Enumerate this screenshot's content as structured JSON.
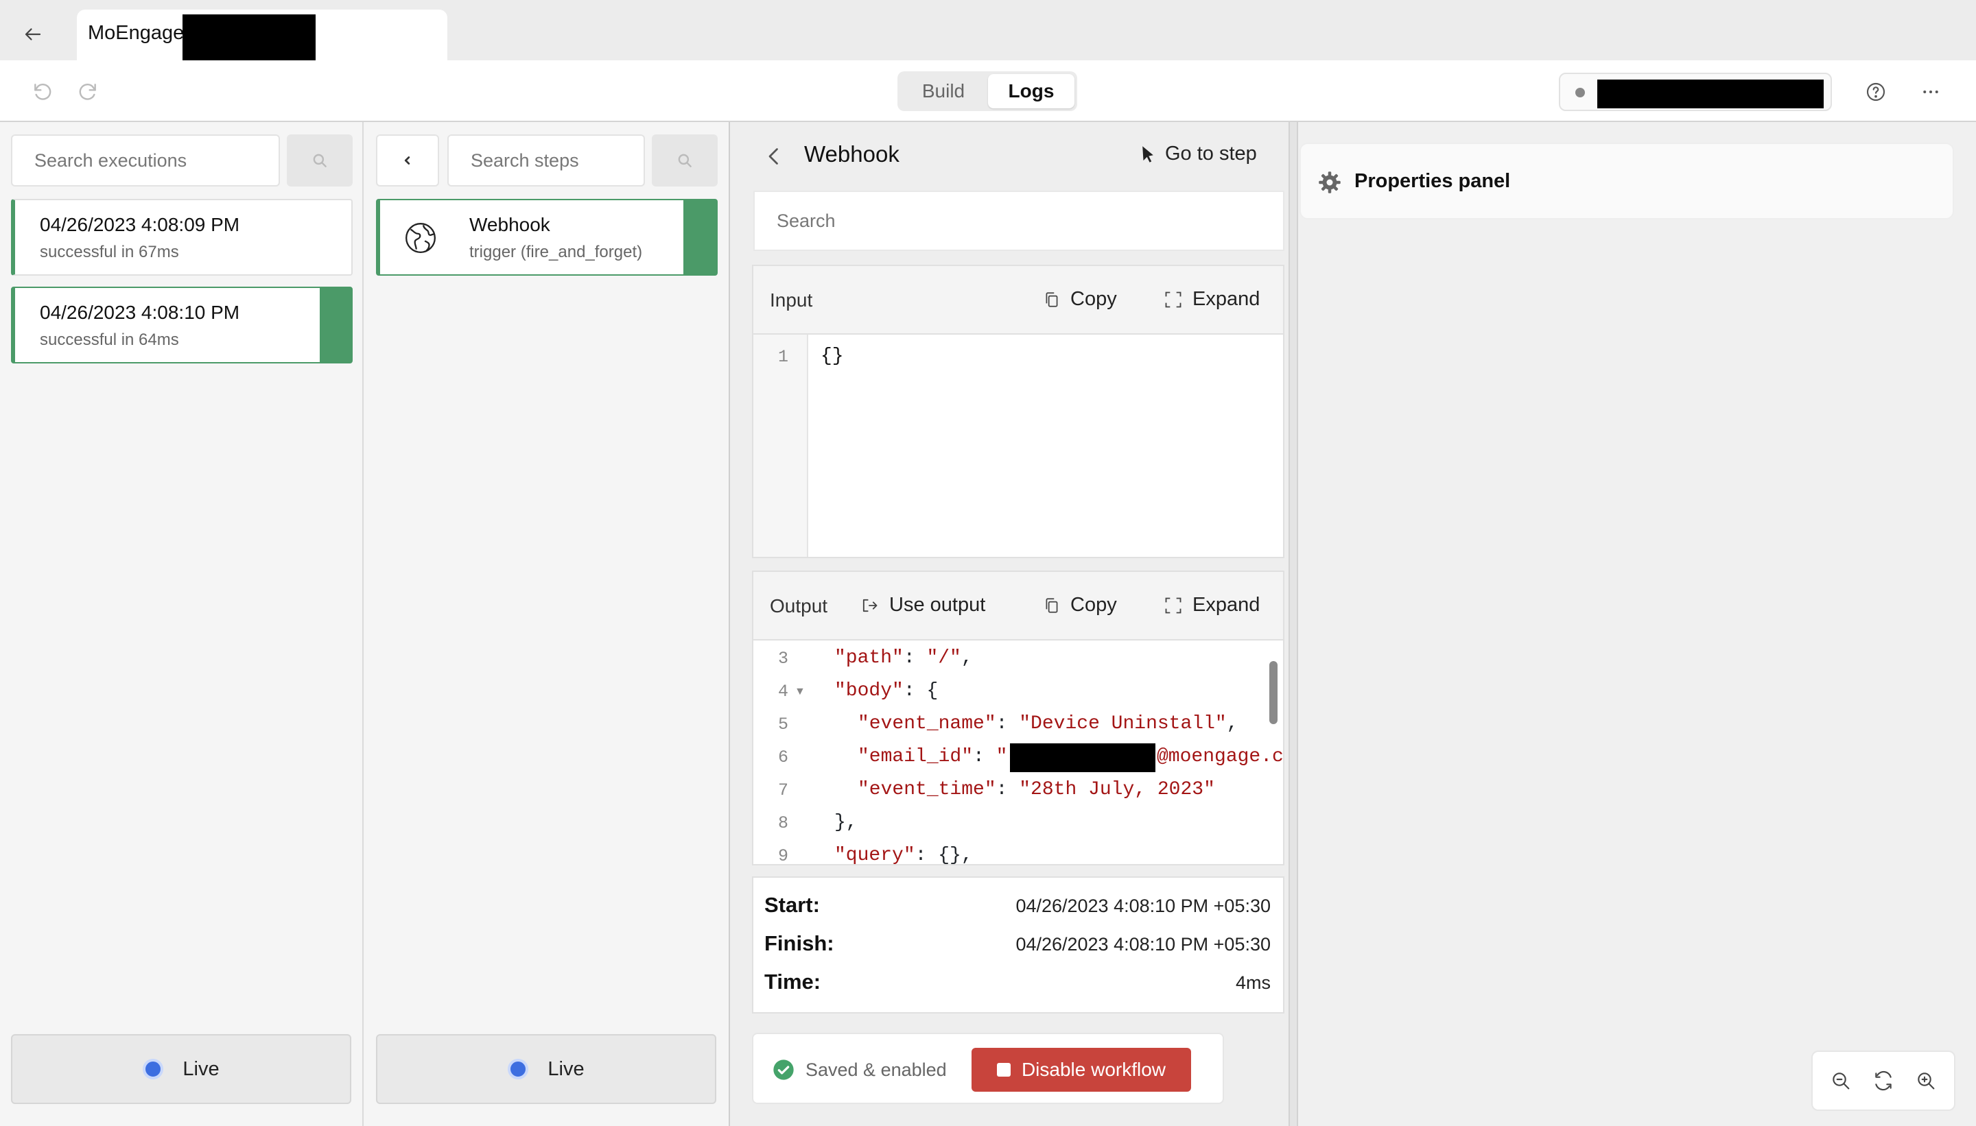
{
  "tab": {
    "title": "MoEngage"
  },
  "toolbar": {
    "build_label": "Build",
    "logs_label": "Logs"
  },
  "executions": {
    "search_placeholder": "Search executions",
    "items": [
      {
        "timestamp": "04/26/2023 4:08:09 PM",
        "status": "successful in 67ms"
      },
      {
        "timestamp": "04/26/2023 4:08:10 PM",
        "status": "successful in 64ms"
      }
    ],
    "live_label": "Live"
  },
  "steps": {
    "search_placeholder": "Search steps",
    "items": [
      {
        "name": "Webhook",
        "subtitle": "trigger (fire_and_forget)"
      }
    ],
    "live_label": "Live"
  },
  "step_detail": {
    "title": "Webhook",
    "go_to_step_label": "Go to step",
    "search_placeholder": "Search",
    "input": {
      "label": "Input",
      "copy_label": "Copy",
      "expand_label": "Expand",
      "line_numbers": [
        "1"
      ],
      "code": "{}"
    },
    "output": {
      "label": "Output",
      "use_output_label": "Use output",
      "copy_label": "Copy",
      "expand_label": "Expand",
      "line_numbers": [
        "3",
        "4",
        "5",
        "6",
        "7",
        "8",
        "9"
      ],
      "lines": [
        {
          "key": "\"path\"",
          "sep": ": ",
          "val": "\"/\"",
          "tail": ","
        },
        {
          "key": "\"body\"",
          "sep": ": ",
          "val": "",
          "tail": "{"
        },
        {
          "key": "\"event_name\"",
          "sep": ": ",
          "val": "\"Device Uninstall\"",
          "tail": ","
        },
        {
          "key": "\"email_id\"",
          "sep": ": ",
          "val": "\"",
          "tail": ""
        },
        {
          "key": "\"event_time\"",
          "sep": ": ",
          "val": "\"28th July, 2023\"",
          "tail": ""
        },
        {
          "key": "",
          "sep": "",
          "val": "",
          "tail": "},"
        },
        {
          "key": "\"query\"",
          "sep": ": ",
          "val": "",
          "tail": "{},"
        }
      ],
      "email_suffix": "@moengage.c"
    },
    "meta": {
      "start_label": "Start:",
      "start_value": "04/26/2023 4:08:10 PM +05:30",
      "finish_label": "Finish:",
      "finish_value": "04/26/2023 4:08:10 PM +05:30",
      "time_label": "Time:",
      "time_value": "4ms"
    },
    "footer": {
      "status_label": "Saved & enabled",
      "disable_label": "Disable workflow"
    }
  },
  "properties": {
    "title": "Properties panel"
  },
  "colors": {
    "accent_green": "#4b9a68",
    "danger": "#c8443c",
    "live_blue": "#3d6ee0",
    "string_red": "#a31515"
  }
}
